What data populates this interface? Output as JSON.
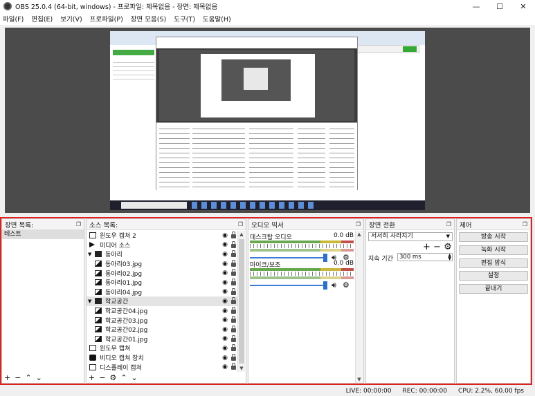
{
  "window": {
    "title": "OBS 25.0.4 (64-bit, windows) - 프로파일: 제목없음 - 장면: 제목없음",
    "min": "—",
    "max": "☐",
    "close": "✕"
  },
  "menu": [
    {
      "label": "파일(F)"
    },
    {
      "label": "편집(E)"
    },
    {
      "label": "보기(V)"
    },
    {
      "label": "프로파일(P)"
    },
    {
      "label": "장면 모음(S)"
    },
    {
      "label": "도구(T)"
    },
    {
      "label": "도움말(H)"
    }
  ],
  "scenes": {
    "title": "장면 목록:",
    "items": [
      "테스트"
    ]
  },
  "sources": {
    "title": "소스 목록:",
    "items": [
      {
        "name": "윈도우 캡쳐 2",
        "icon": "window"
      },
      {
        "name": "미디어 소스",
        "icon": "play"
      },
      {
        "name": "동아리",
        "icon": "folder"
      },
      {
        "name": "동아리03.jpg",
        "icon": "image"
      },
      {
        "name": "동아리02.jpg",
        "icon": "image"
      },
      {
        "name": "동아리01.jpg",
        "icon": "image"
      },
      {
        "name": "동아리04.jpg",
        "icon": "image"
      },
      {
        "name": "학교공간",
        "icon": "folder"
      },
      {
        "name": "학교공간04.jpg",
        "icon": "image"
      },
      {
        "name": "학교공간03.jpg",
        "icon": "image"
      },
      {
        "name": "학교공간02.jpg",
        "icon": "image"
      },
      {
        "name": "학교공간01.jpg",
        "icon": "image"
      },
      {
        "name": "윈도우 캡쳐",
        "icon": "window"
      },
      {
        "name": "비디오 캡쳐 장치",
        "icon": "camera"
      },
      {
        "name": "디스플레이 캡쳐",
        "icon": "display"
      }
    ]
  },
  "mixer": {
    "title": "오디오 믹서",
    "channels": [
      {
        "name": "데스크탑 오디오",
        "db": "0.0 dB",
        "volume": 1.0
      },
      {
        "name": "마이크/보조",
        "db": "0.0 dB",
        "volume": 1.0
      }
    ]
  },
  "transitions": {
    "title": "장면 전환",
    "selected": "서서히 사라지기",
    "duration_label": "지속 기간",
    "duration_value": "300 ms"
  },
  "controls": {
    "title": "제어",
    "buttons": [
      "방송 시작",
      "녹화 시작",
      "편집 방식",
      "설정",
      "끝내기"
    ]
  },
  "status": {
    "live": "LIVE: 00:00:00",
    "rec": "REC: 00:00:00",
    "cpu": "CPU: 2.2%, 60.00 fps"
  }
}
